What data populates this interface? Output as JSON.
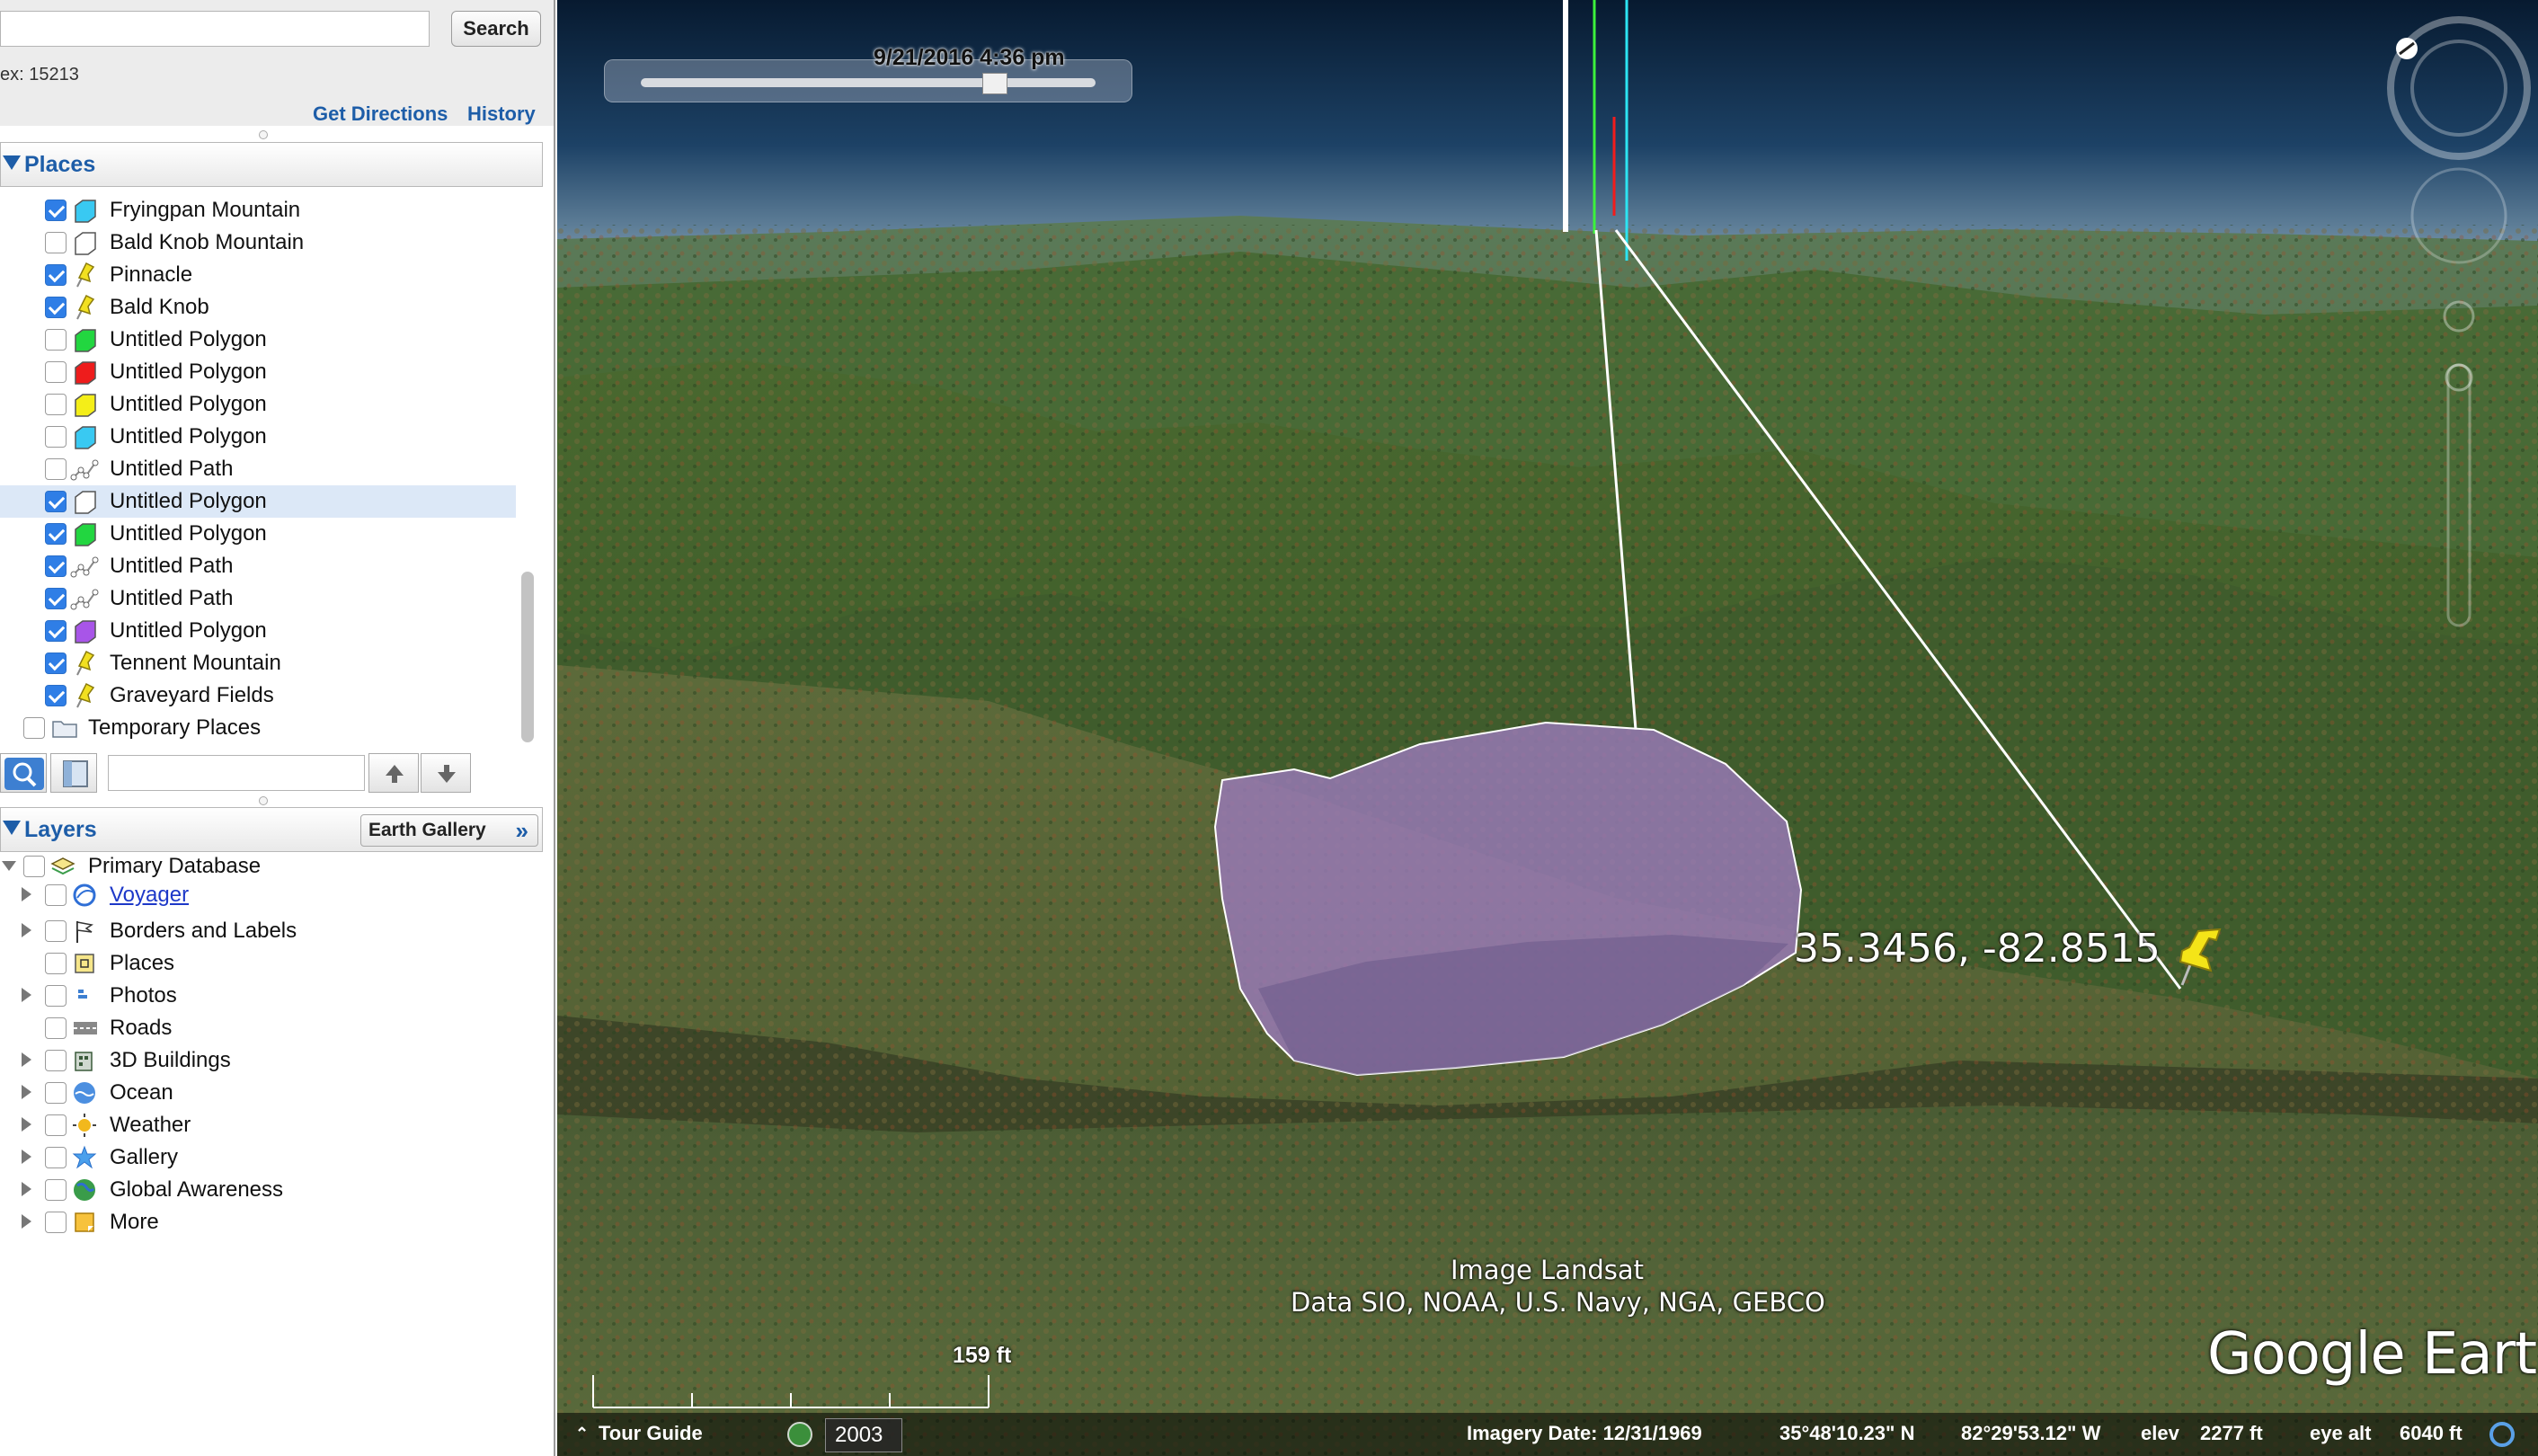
{
  "search": {
    "button_label": "Search",
    "hint": "ex: 15213",
    "get_directions": "Get Directions",
    "history": "History"
  },
  "places": {
    "title": "Places",
    "items": [
      {
        "label": "Fryingpan Mountain",
        "checked": true,
        "icon": "polygon-icon",
        "color": "#39c9f2"
      },
      {
        "label": "Bald Knob Mountain",
        "checked": false,
        "icon": "polygon-icon",
        "color": "#ffffff"
      },
      {
        "label": "Pinnacle",
        "checked": true,
        "icon": "pushpin-icon",
        "color": "#f2e020"
      },
      {
        "label": "Bald Knob",
        "checked": true,
        "icon": "pushpin-icon",
        "color": "#f2e020"
      },
      {
        "label": "Untitled Polygon",
        "checked": false,
        "icon": "polygon-icon",
        "color": "#22d640"
      },
      {
        "label": "Untitled Polygon",
        "checked": false,
        "icon": "polygon-icon",
        "color": "#ee1c1c"
      },
      {
        "label": "Untitled Polygon",
        "checked": false,
        "icon": "polygon-icon",
        "color": "#f4ee18"
      },
      {
        "label": "Untitled Polygon",
        "checked": false,
        "icon": "polygon-icon",
        "color": "#39c9f2"
      },
      {
        "label": "Untitled Path",
        "checked": false,
        "icon": "path-icon",
        "color": "#888888"
      },
      {
        "label": "Untitled Polygon",
        "checked": true,
        "icon": "polygon-icon",
        "color": "#ffffff",
        "selected": true
      },
      {
        "label": "Untitled Polygon",
        "checked": true,
        "icon": "polygon-icon",
        "color": "#22d640"
      },
      {
        "label": "Untitled Path",
        "checked": true,
        "icon": "path-icon",
        "color": "#888888"
      },
      {
        "label": "Untitled Path",
        "checked": true,
        "icon": "path-icon",
        "color": "#888888"
      },
      {
        "label": "Untitled Polygon",
        "checked": true,
        "icon": "polygon-icon",
        "color": "#a855e8"
      },
      {
        "label": "Tennent Mountain",
        "checked": true,
        "icon": "pushpin-icon",
        "color": "#f2e020"
      },
      {
        "label": "Graveyard Fields",
        "checked": true,
        "icon": "pushpin-icon",
        "color": "#f2e020"
      }
    ],
    "temporary_places": "Temporary Places"
  },
  "layers": {
    "title": "Layers",
    "earth_gallery": "Earth Gallery",
    "primary_database": "Primary Database",
    "items": [
      {
        "label": "Voyager",
        "link": true,
        "expander": true,
        "icon": "voyager-icon"
      },
      {
        "label": "Borders and Labels",
        "expander": true,
        "icon": "flag-icon"
      },
      {
        "label": "Places",
        "expander": false,
        "icon": "places-layer-icon"
      },
      {
        "label": "Photos",
        "expander": true,
        "icon": "photos-icon"
      },
      {
        "label": "Roads",
        "expander": false,
        "icon": "roads-icon"
      },
      {
        "label": "3D Buildings",
        "expander": true,
        "icon": "buildings-icon"
      },
      {
        "label": "Ocean",
        "expander": true,
        "icon": "ocean-icon"
      },
      {
        "label": "Weather",
        "expander": true,
        "icon": "weather-icon"
      },
      {
        "label": "Gallery",
        "expander": true,
        "icon": "gallery-icon"
      },
      {
        "label": "Global Awareness",
        "expander": true,
        "icon": "globe-icon"
      },
      {
        "label": "More",
        "expander": true,
        "icon": "more-icon"
      }
    ]
  },
  "map": {
    "time_label": "9/21/2016   4:36 pm",
    "coordinate_label": "35.3456, -82.8515",
    "attribution_line1": "Image Landsat",
    "attribution_line2": "Data SIO, NOAA, U.S. Navy, NGA, GEBCO",
    "logo": "Google Earth",
    "scale_label": "159 ft",
    "polygon_color": "#9a7ab8"
  },
  "status_bar": {
    "tour_guide": "Tour Guide",
    "year": "2003",
    "imagery_date": "Imagery Date: 12/31/1969",
    "latitude": "35°48'10.23\" N",
    "longitude": "82°29'53.12\" W",
    "elev_label": "elev",
    "elev_value": "2277 ft",
    "eye_alt_label": "eye alt",
    "eye_alt_value": "6040 ft"
  }
}
